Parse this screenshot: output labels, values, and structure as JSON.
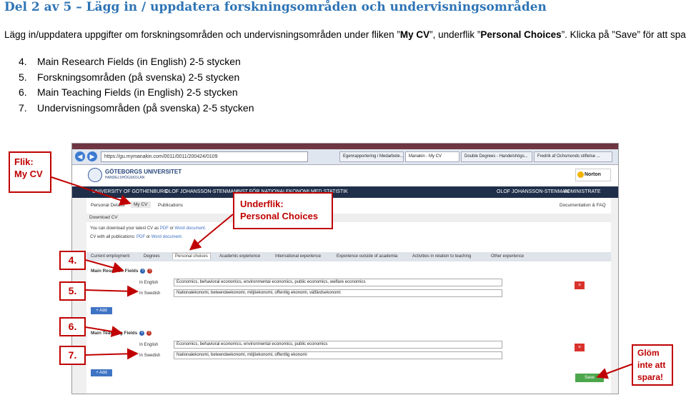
{
  "title": "Del 2 av 5 – Lägg in / uppdatera forskningsområden och undervisningsområden",
  "intro": {
    "before": "Lägg in/uppdatera uppgifter om forskningsområden och undervisningsområden under fliken ”",
    "tab": "My CV",
    "middle": "”, underflik ”",
    "subtab": "Personal Choices",
    "after": "”. Klicka på ”Save” för att spara!"
  },
  "steps": [
    {
      "num": "4.",
      "text": "Main Research Fields (in English) 2-5 stycken"
    },
    {
      "num": "5.",
      "text": "Forskningsområden (på svenska) 2-5 stycken"
    },
    {
      "num": "6.",
      "text": "Main Teaching Fields (in English) 2-5 stycken"
    },
    {
      "num": "7.",
      "text": "Undervisningsområden (på svenska) 2-5 stycken"
    }
  ],
  "callouts": {
    "flik": [
      "Flik:",
      "My CV"
    ],
    "underflik": [
      "Underflik:",
      "Personal Choices"
    ],
    "glom": [
      "Glöm",
      "inte att",
      "spara!"
    ]
  },
  "step_tags": [
    "4.",
    "5.",
    "6.",
    "7."
  ],
  "screenshot": {
    "address": "https://gu.mymanakin.com/0011/0011/200424/0109",
    "tabs": [
      "Egenrapportering i Medarbete...",
      "Manakin - My CV",
      "Double Degrees - Handelshögs...",
      "Fredrik af Ochsmonds stiftelse ..."
    ],
    "logo": [
      "GÖTEBORGS UNIVERSITET",
      "HANDELSHÖGSKOLAN"
    ],
    "norton": "Norton",
    "crumbs": [
      "UNIVERSITY OF GOTHENBURG",
      "OLOF JOHANSSON-STENMAN",
      "INST FÖR NATIONALEKONOMI MED STATISTIK"
    ],
    "crumbs_right": [
      "OLOF JOHANSSON-STENMAN",
      "ADMINISTRATE"
    ],
    "subnav": [
      "Personal Details",
      "My CV",
      "Publications"
    ],
    "doc_faq": "Documentation & FAQ",
    "download_cv": "Download CV",
    "cv_line1": "You can download your latest CV as",
    "pdf": "PDF",
    "or": "or",
    "word_doc": "Word document.",
    "cv_line2": "CV with all publications:",
    "tabs_personal": [
      "Current employment",
      "Degrees",
      "Personal choices",
      "Academic experience",
      "International experience",
      "Experience outside of academia",
      "Activities in relation to teaching",
      "Other experience"
    ],
    "research_title": "Main Research Fields",
    "teaching_title": "Main Teaching Fields",
    "in_english": "In English",
    "in_swedish": "In Swedish",
    "research_en": "Economics, behavioral economics, environmental economics, public economics, welfare economics",
    "research_sv": "Nationalekonomi, beteendeekonomi, miljöekonomi, offentlig ekonomi, välfärdsekonomi",
    "teaching_en": "Economics, behavioral economics, environmental economics, public economics",
    "teaching_sv": "Nationalekonomi, beteendeekonomi, miljöekonomi, offentlig ekonomi",
    "add": "+ Add",
    "x": "×",
    "save": "Save"
  },
  "colors": {
    "title": "#2e74b5",
    "callout": "#c00000",
    "crumbbar": "#1f2f4a",
    "add": "#3f74c4",
    "save": "#4ca64c",
    "delete": "#d9322b"
  }
}
